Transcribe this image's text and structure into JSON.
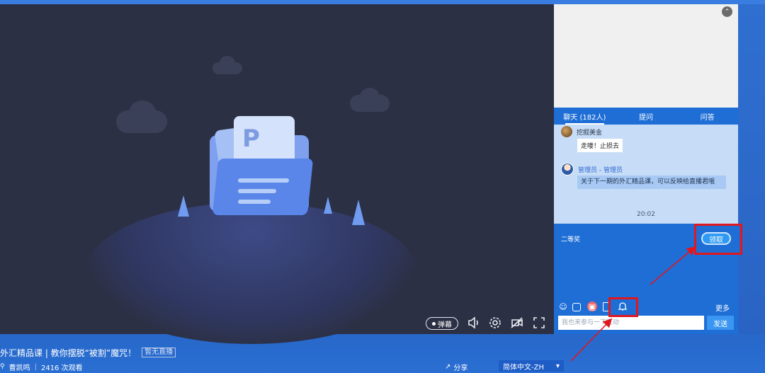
{
  "player": {
    "danmu_label": "弹幕",
    "icons": [
      "volume-icon",
      "settings-icon",
      "video-off-icon",
      "fullscreen-icon"
    ]
  },
  "info": {
    "title": "外汇精品课 | 教你摆脱“被割”魔咒！",
    "status_badge": "暂无直播",
    "host": "曹凯鸣",
    "viewers": "2416 次观看",
    "share_label": "分享",
    "language": "简体中文-ZH"
  },
  "panel": {
    "collapse_icon": "chevron-up-icon",
    "tabs": [
      {
        "label": "聊天 (182人)",
        "active": true
      },
      {
        "label": "提问",
        "active": false
      },
      {
        "label": "问答",
        "active": false
      }
    ],
    "messages": [
      {
        "name": "挖掘美金",
        "text": "走喽！止损去",
        "role": "user"
      },
      {
        "name": "管理员 - 管理员",
        "text": "关于下一期的外汇精品课，可以反映给直播君哦",
        "role": "admin"
      }
    ],
    "time": "20:02",
    "prize": {
      "label": "二等奖",
      "claim_label": "领取"
    },
    "toolbar": {
      "icons": [
        "emoji-icon",
        "image-icon",
        "gift-icon",
        "clipboard-icon",
        "bell-icon"
      ],
      "more_label": "更多"
    },
    "input": {
      "placeholder": "我也来参与一下互动",
      "send_label": "发送"
    }
  },
  "colors": {
    "accent": "#1e6ed6",
    "highlight": "#e0171f",
    "player_bg": "#2c3044"
  }
}
